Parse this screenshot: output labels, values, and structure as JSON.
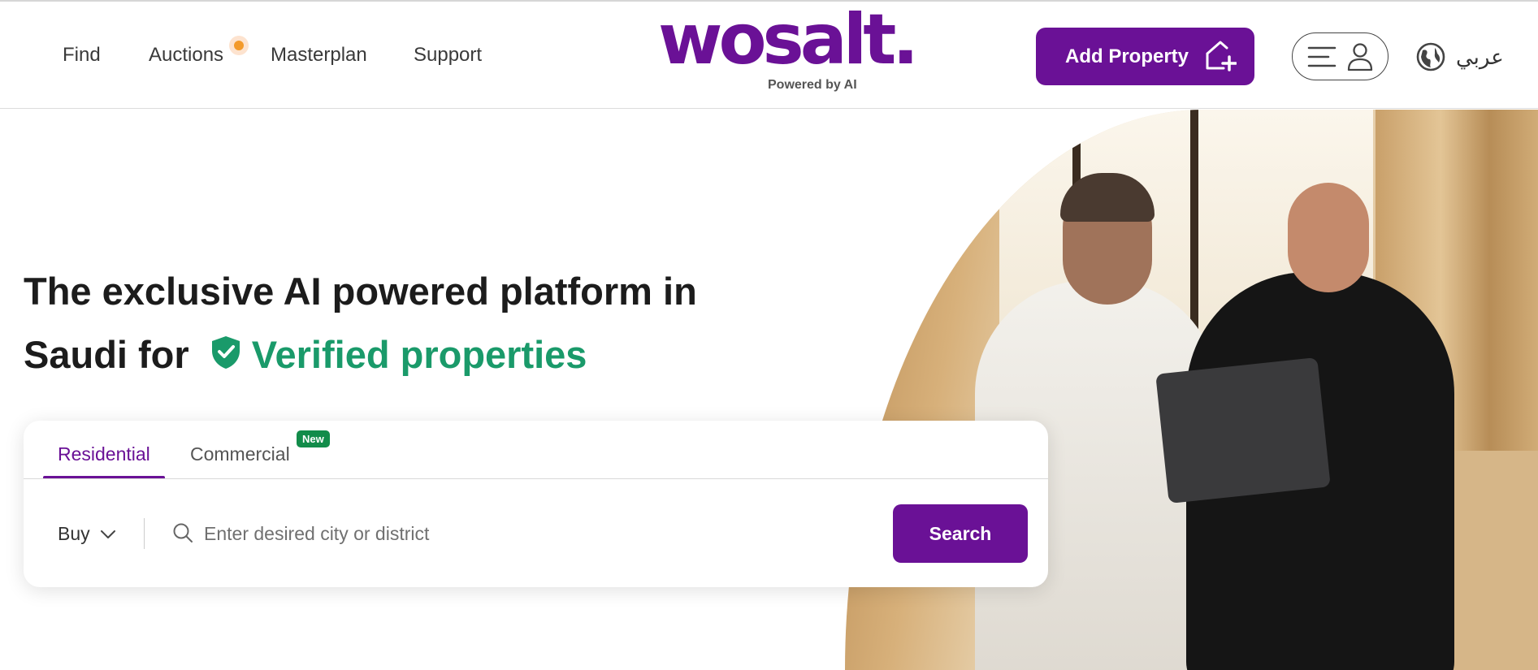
{
  "header": {
    "nav": [
      {
        "label": "Find"
      },
      {
        "label": "Auctions"
      },
      {
        "label": "Masterplan"
      },
      {
        "label": "Support"
      }
    ],
    "logo": {
      "wordmark": "wosalt.",
      "tagline": "Powered by AI"
    },
    "add_property_label": "Add Property",
    "language_label": "عربي"
  },
  "hero": {
    "headline_line1": "The exclusive AI powered platform in",
    "headline_line2_prefix": "Saudi for",
    "headline_highlight": "Verified properties"
  },
  "search": {
    "tabs": [
      {
        "label": "Residential",
        "active": true
      },
      {
        "label": "Commercial",
        "active": false,
        "badge": "New"
      }
    ],
    "purpose_value": "Buy",
    "placeholder": "Enter desired city or district",
    "button_label": "Search"
  },
  "colors": {
    "brand": "#6a1196",
    "verified_green": "#1a9a6a",
    "new_badge": "#128c4a",
    "live_dot": "#f39a2b"
  },
  "icons": [
    "live-indicator-icon",
    "add-home-icon",
    "menu-icon",
    "user-icon",
    "globe-icon",
    "shield-check-icon",
    "chevron-down-icon",
    "search-icon"
  ]
}
